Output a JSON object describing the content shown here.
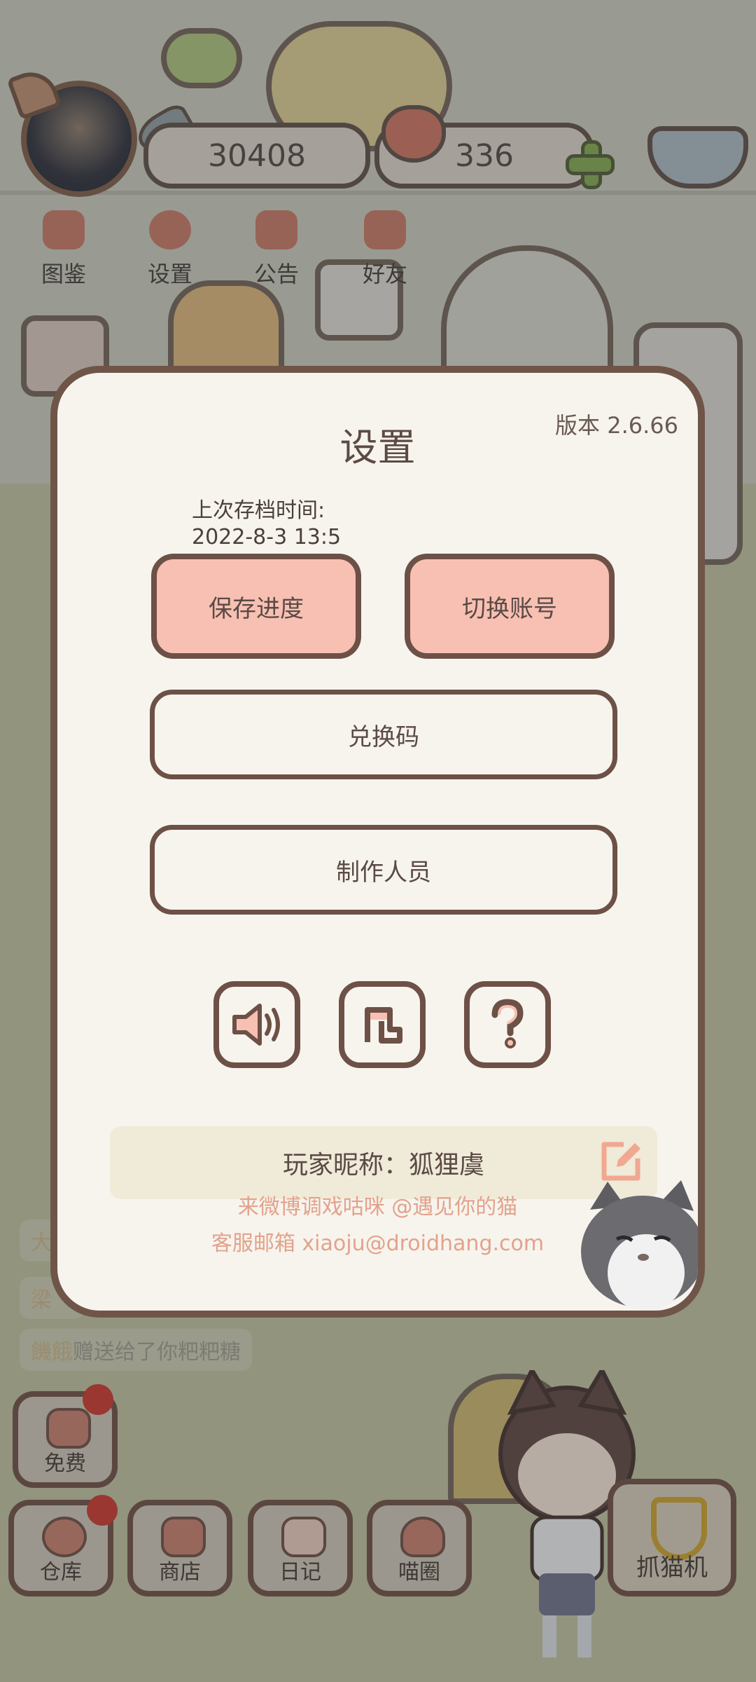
{
  "topbar": {
    "fish_count": "30408",
    "heart_count": "336"
  },
  "topnav": [
    {
      "label": "图鉴"
    },
    {
      "label": "设置"
    },
    {
      "label": "公告"
    },
    {
      "label": "好友"
    }
  ],
  "dialog": {
    "title": "设置",
    "version": "版本 2.6.66",
    "save_info_label": "上次存档时间:",
    "save_info_time": "2022-8-3 13:5",
    "save_button": "保存进度",
    "switch_account_button": "切换账号",
    "redeem_code_button": "兑换码",
    "credits_button": "制作人员",
    "nickname_label": "玩家昵称：狐狸虞",
    "weibo_link": "来微博调戏咕咪 @遇见你的猫",
    "support_email": "客服邮箱 xiaoju@droidhang.com"
  },
  "chat": {
    "line1": "大",
    "line2": "梁",
    "line3_name": "饑餓",
    "line3_text": "赠送给了你粑粑糖"
  },
  "bottom": {
    "free": "免费",
    "warehouse": "仓库",
    "shop": "商店",
    "diary": "日记",
    "meow_circle": "喵圈",
    "claw_machine": "抓猫机"
  },
  "colors": {
    "dialog_bg": "#f7f4ee",
    "border": "#6f5548",
    "pink_button": "#f7c0b3",
    "link_text": "#e3a28b"
  }
}
